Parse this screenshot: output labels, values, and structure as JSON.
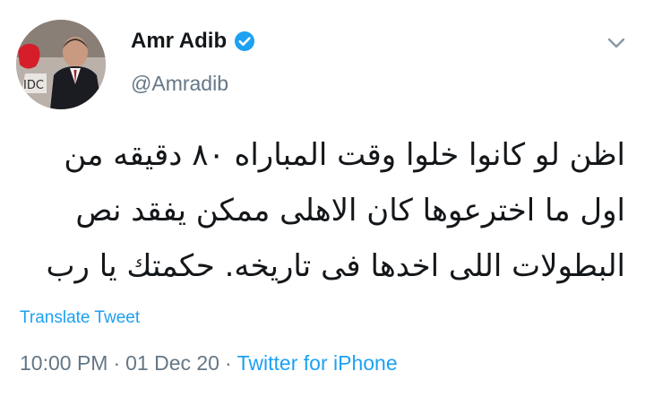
{
  "author": {
    "display_name": "Amr Adib",
    "handle": "@Amradib",
    "avatar_sign_text": "IDC"
  },
  "icons": {
    "verified": "verified-badge-icon",
    "more": "chevron-down-icon"
  },
  "tweet": {
    "text": "اظن لو كانوا خلوا وقت المباراه ٨٠ دقيقه من اول ما اخترعوها كان الاهلى ممكن يفقد نص البطولات اللى اخدها فى تاريخه. حكمتك يا رب"
  },
  "translate_label": "Translate Tweet",
  "meta": {
    "time": "10:00 PM",
    "separator": "·",
    "date": "01 Dec 20",
    "source": "Twitter for iPhone"
  },
  "colors": {
    "link": "#1da1f2",
    "secondary_text": "#657786",
    "primary_text": "#14171a"
  }
}
